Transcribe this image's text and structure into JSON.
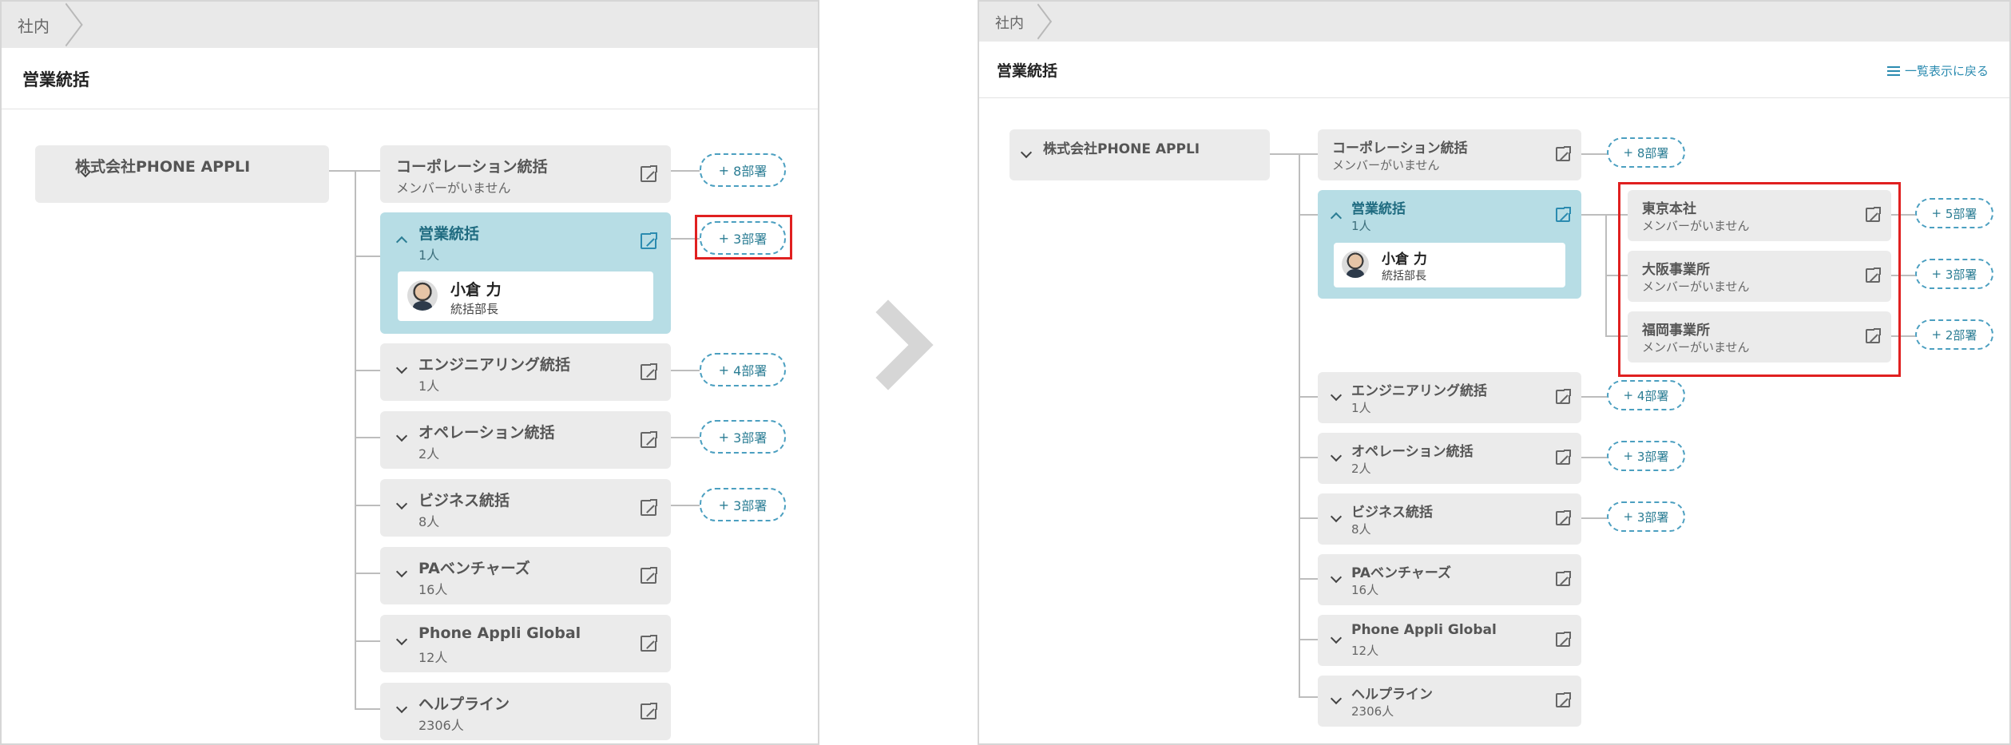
{
  "breadcrumb": "社内",
  "page_title": "営業統括",
  "back_link": "一覧表示に戻る",
  "root": {
    "name": "株式会社PHONE APPLI"
  },
  "departments": [
    {
      "name": "コーポレーション統括",
      "sub": "メンバーがいません",
      "more": "8部署"
    },
    {
      "name": "営業統括",
      "sub": "1人",
      "more": "3部署",
      "expanded": true
    },
    {
      "name": "エンジニアリング統括",
      "sub": "1人",
      "more": "4部署"
    },
    {
      "name": "オペレーション統括",
      "sub": "2人",
      "more": "3部署"
    },
    {
      "name": "ビジネス統括",
      "sub": "8人",
      "more": "3部署"
    },
    {
      "name": "PAベンチャーズ",
      "sub": "16人"
    },
    {
      "name": "Phone Appli Global",
      "sub": "12人"
    },
    {
      "name": "ヘルプライン",
      "sub": "2306人"
    }
  ],
  "member": {
    "name": "小倉 力",
    "role": "統括部長"
  },
  "sub_departments": [
    {
      "name": "東京本社",
      "sub": "メンバーがいません",
      "more": "5部署"
    },
    {
      "name": "大阪事業所",
      "sub": "メンバーがいません",
      "more": "3部署"
    },
    {
      "name": "福岡事業所",
      "sub": "メンバーがいません",
      "more": "2部署"
    }
  ],
  "colors": {
    "accent": "#2b8bb0",
    "active_card": "#b7dde5",
    "highlight": "#e02020",
    "card": "#ebebeb"
  },
  "icons": [
    "chevron-down-icon",
    "chevron-up-icon",
    "external-link-icon",
    "plus-icon",
    "list-icon",
    "arrow-right-icon"
  ]
}
